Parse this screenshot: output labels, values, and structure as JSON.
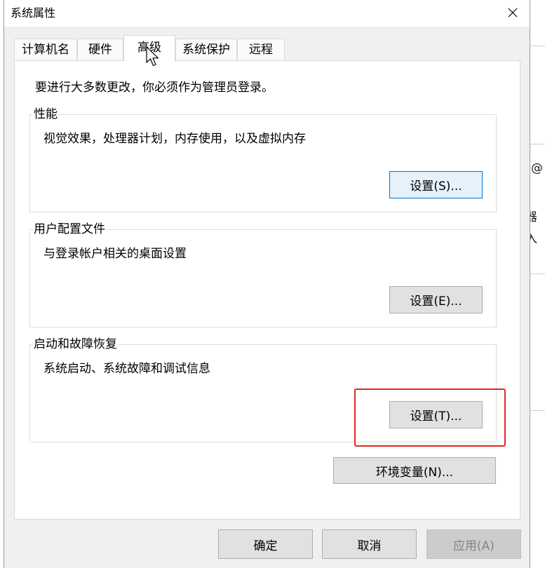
{
  "window": {
    "title": "系统属性"
  },
  "tabs": [
    {
      "label": "计算机名",
      "selected": false
    },
    {
      "label": "硬件",
      "selected": false
    },
    {
      "label": "高级",
      "selected": true
    },
    {
      "label": "系统保护",
      "selected": false
    },
    {
      "label": "远程",
      "selected": false
    }
  ],
  "panel": {
    "admin_note": "要进行大多数更改，你必须作为管理员登录。",
    "groups": [
      {
        "title": "性能",
        "description": "视觉效果，处理器计划，内存使用，以及虚拟内存",
        "button": "设置(S)..."
      },
      {
        "title": "用户配置文件",
        "description": "与登录帐户相关的桌面设置",
        "button": "设置(E)..."
      },
      {
        "title": "启动和故障恢复",
        "description": "系统启动、系统故障和调试信息",
        "button": "设置(T)..."
      }
    ],
    "env_button": "环境变量(N)..."
  },
  "footer": {
    "ok": "确定",
    "cancel": "取消",
    "apply": "应用(A)"
  },
  "background_window": {
    "fragments": [
      "@",
      "器",
      "入"
    ]
  },
  "icons": {
    "close": "close-icon",
    "cursor": "mouse-cursor-icon"
  },
  "colors": {
    "focus_border": "#0078d7",
    "focus_fill": "#e5f1fb",
    "highlight": "#e3261f",
    "dialog_bg": "#f0f0f0"
  }
}
